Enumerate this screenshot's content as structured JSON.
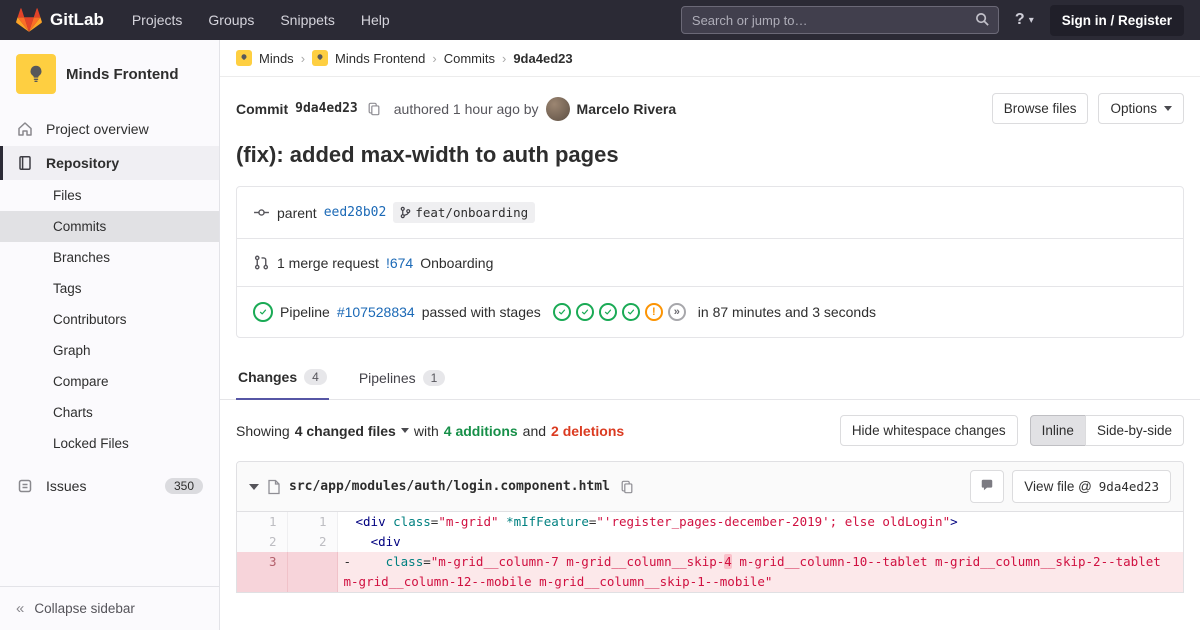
{
  "navbar": {
    "brand": "GitLab",
    "links": [
      "Projects",
      "Groups",
      "Snippets",
      "Help"
    ],
    "search_placeholder": "Search or jump to…",
    "sign_in_label": "Sign in / Register"
  },
  "sidebar": {
    "project_name": "Minds Frontend",
    "overview_label": "Project overview",
    "repository_label": "Repository",
    "repo_items": [
      "Files",
      "Commits",
      "Branches",
      "Tags",
      "Contributors",
      "Graph",
      "Compare",
      "Charts",
      "Locked Files"
    ],
    "issues_label": "Issues",
    "issues_count": "350",
    "collapse_label": "Collapse sidebar"
  },
  "breadcrumb": {
    "minds": "Minds",
    "minds_frontend": "Minds Frontend",
    "commits": "Commits",
    "sha": "9da4ed23"
  },
  "commit": {
    "label": "Commit",
    "sha": "9da4ed23",
    "authored": "authored 1 hour ago by",
    "author": "Marcelo Rivera",
    "browse_files_label": "Browse files",
    "options_label": "Options",
    "title": "(fix): added max-width to auth pages"
  },
  "info": {
    "parent_label": "parent",
    "parent_sha": "eed28b02",
    "branch": "feat/onboarding",
    "mr_count_text": "1 merge request",
    "mr_id": "!674",
    "mr_name": "Onboarding",
    "pipeline_label": "Pipeline",
    "pipeline_id": "#107528834",
    "pipeline_status_text": "passed with stages",
    "pipeline_stages": [
      "passed",
      "passed",
      "passed",
      "passed",
      "warning",
      "skipped"
    ],
    "pipeline_duration": "in 87 minutes and 3 seconds"
  },
  "tabs": {
    "changes_label": "Changes",
    "changes_count": "4",
    "pipelines_label": "Pipelines",
    "pipelines_count": "1"
  },
  "summary": {
    "showing": "Showing",
    "changed_files": "4 changed files",
    "with": "with",
    "additions": "4 additions",
    "and": "and",
    "deletions": "2 deletions",
    "hide_whitespace_label": "Hide whitespace changes",
    "inline_label": "Inline",
    "side_by_side_label": "Side-by-side"
  },
  "file": {
    "path": "src/app/modules/auth/login.component.html",
    "view_file_label": "View file @",
    "view_file_sha": "9da4ed23"
  },
  "diff": {
    "rows": [
      {
        "old": "1",
        "new": "1",
        "type": "context",
        "marker": "",
        "segments": [
          {
            "t": "<div",
            "c": "nt"
          },
          {
            "t": " ",
            "c": ""
          },
          {
            "t": "class",
            "c": "na"
          },
          {
            "t": "=",
            "c": ""
          },
          {
            "t": "\"m-grid\"",
            "c": "s"
          },
          {
            "t": " ",
            "c": ""
          },
          {
            "t": "*mIfFeature",
            "c": "na"
          },
          {
            "t": "=",
            "c": ""
          },
          {
            "t": "\"'register_pages-december-2019'; else oldLogin\"",
            "c": "s"
          },
          {
            "t": ">",
            "c": "nt"
          }
        ]
      },
      {
        "old": "2",
        "new": "2",
        "type": "context",
        "marker": "",
        "segments": [
          {
            "t": "  ",
            "c": ""
          },
          {
            "t": "<div",
            "c": "nt"
          }
        ]
      },
      {
        "old": "3",
        "new": "",
        "type": "deletion",
        "marker": "-",
        "segments": [
          {
            "t": "    ",
            "c": ""
          },
          {
            "t": "class",
            "c": "na"
          },
          {
            "t": "=",
            "c": ""
          },
          {
            "t": "\"m-grid__column-7 m-grid__column__skip-",
            "c": "s"
          },
          {
            "t": "4",
            "c": "s hl"
          },
          {
            "t": " m-grid__column-10--tablet m-grid__column__skip-2--tablet m-grid__column-12--mobile m-grid__column__skip-1--mobile\"",
            "c": "s"
          }
        ]
      }
    ]
  }
}
